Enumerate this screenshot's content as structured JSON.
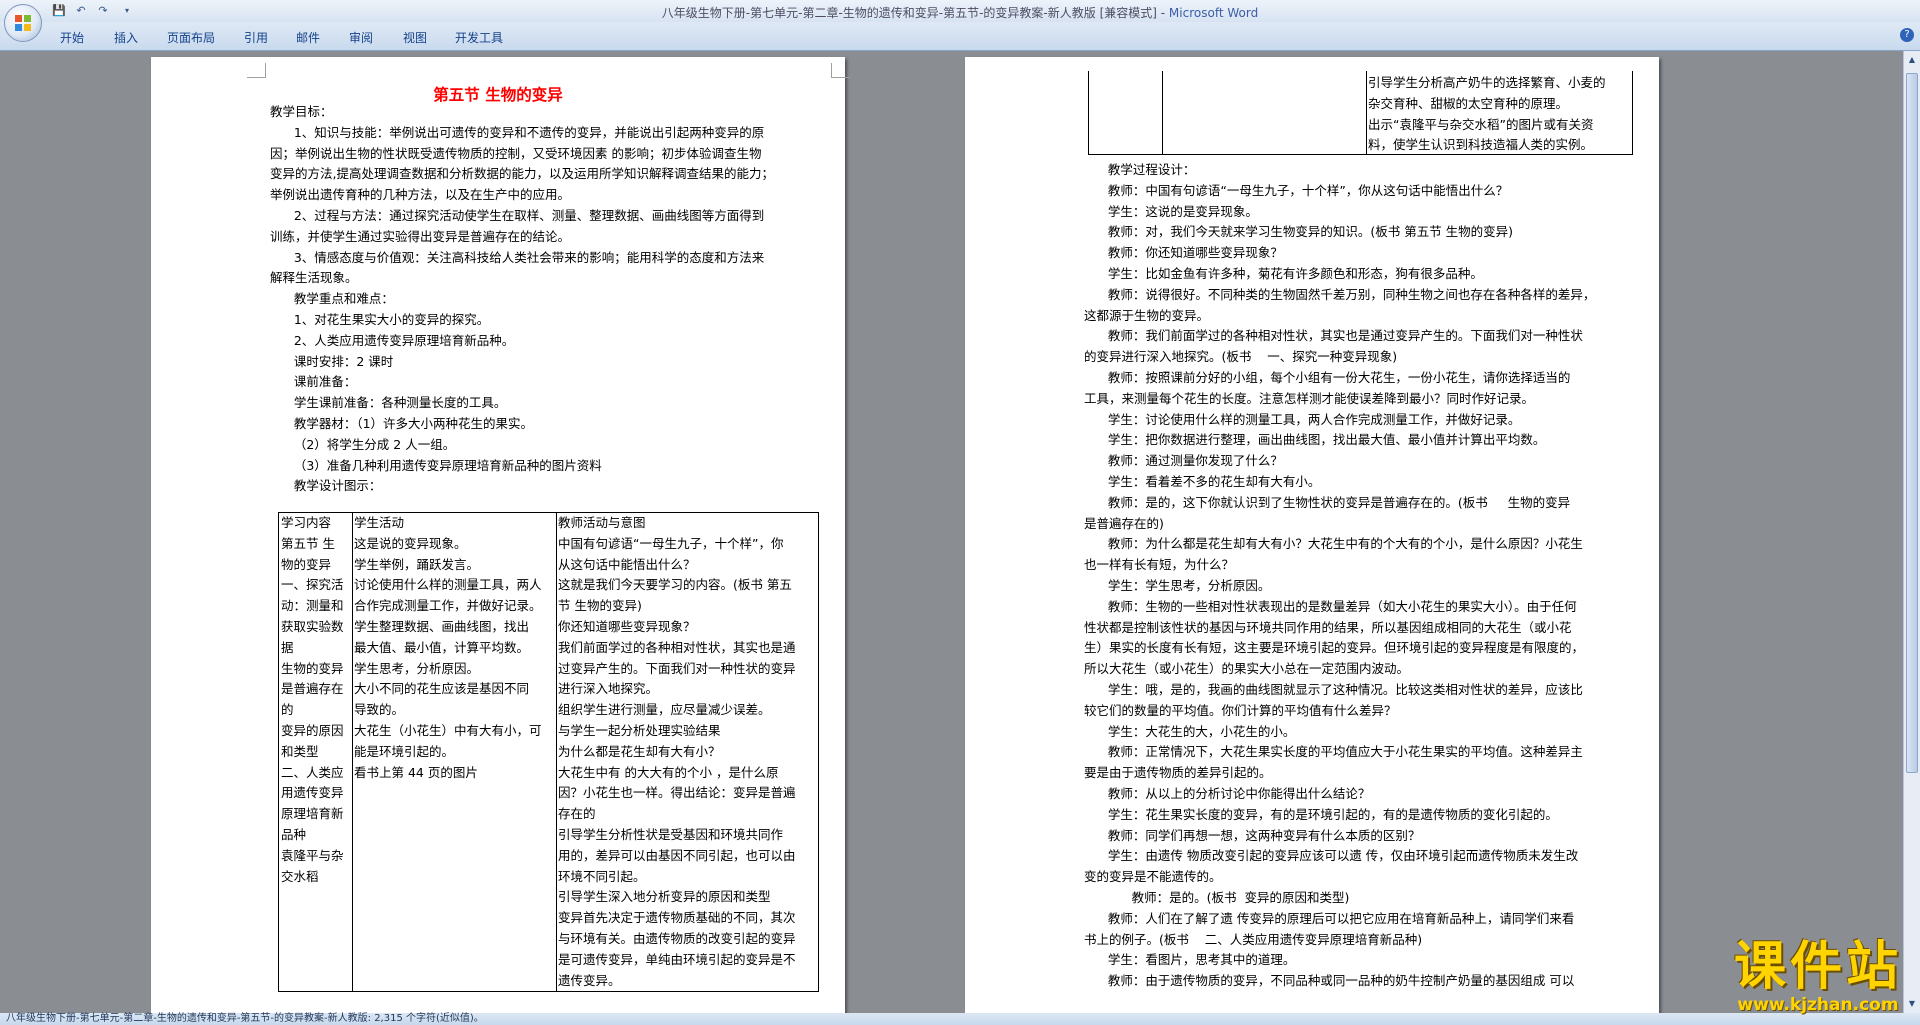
{
  "window": {
    "title": "八年级生物下册-第七单元-第二章-生物的遗传和变异-第五节-的变异教案-新人教版 [兼容模式]",
    "app_name": "Microsoft Word"
  },
  "quick_access": {
    "save_icon": "save-icon",
    "undo_icon": "undo-icon",
    "redo_icon": "redo-icon"
  },
  "ribbon": {
    "tabs": [
      "开始",
      "插入",
      "页面布局",
      "引用",
      "邮件",
      "审阅",
      "视图",
      "开发工具"
    ]
  },
  "left_page": {
    "title": "第五节  生物的变异",
    "lines": [
      "教学目标：",
      "      1、知识与技能：举例说出可遗传的变异和不遗传的变异，并能说出引起两种变异的原",
      "因；举例说出生物的性状既受遗传物质的控制，又受环境因素 的影响；初步体验调查生物",
      "变异的方法,提高处理调查数据和分析数据的能力，以及运用所学知识解释调查结果的能力；",
      "举例说出遗传育种的几种方法，以及在生产中的应用。",
      "      2、过程与方法：通过探究活动使学生在取样、测量、整理数据、画曲线图等方面得到",
      "训练，并使学生通过实验得出变异是普遍存在的结论。",
      "      3、情感态度与价值观：关注高科技给人类社会带来的影响；能用科学的态度和方法来",
      "解释生活现象。",
      "      教学重点和难点：",
      "      1、对花生果实大小的变异的探究。",
      "      2、人类应用遗传变异原理培育新品种。",
      "      课时安排：2 课时",
      "      课前准备：",
      "      学生课前准备：各种测量长度的工具。",
      "      教学器材：（1）许多大小两种花生的果实。",
      "      （2）将学生分成 2 人一组。",
      "      （3）准备几种利用遗传变异原理培育新品种的图片资料",
      "      教学设计图示："
    ],
    "table": {
      "col1": [
        "学习内容",
        "第五节  生",
        "物的变异",
        "一、探究活",
        "动：测量和",
        "获取实验数",
        "据",
        "生物的变异",
        "是普遍存在",
        "的",
        "变异的原因",
        "和类型",
        "二、人类应",
        "用遗传变异",
        "原理培育新",
        "品种",
        "袁隆平与杂",
        "交水稻"
      ],
      "col2": [
        "学生活动",
        "这是说的变异现象。",
        "学生举例，踊跃发言。",
        "讨论使用什么样的测量工具，两人",
        "合作完成测量工作，并做好记录。",
        "学生整理数据、画曲线图，找出",
        "最大值、最小值，计算平均数。",
        "学生思考，分析原因。",
        "大小不同的花生应该是基因不同",
        "导致的。",
        "大花生（小花生）中有大有小，可",
        "能是环境引起的。",
        "看书上第 44 页的图片"
      ],
      "col3": [
        "教师活动与意图",
        "中国有句谚语“一母生九子，十个样”，你",
        "从这句话中能悟出什么？",
        "这就是我们今天要学习的内容。(板书 第五",
        "节 生物的变异)",
        "你还知道哪些变异现象？",
        "我们前面学过的各种相对性状，其实也是通",
        "过变异产生的。下面我们对一种性状的变异",
        "进行深入地探究。",
        "组织学生进行测量，应尽量减少误差。",
        "与学生一起分析处理实验结果",
        "为什么都是花生却有大有小？",
        "大花生中有 的大大有的个小 ，是什么原",
        "因？小花生也一样。得出结论：变异是普遍",
        "存在的",
        "引导学生分析性状是受基因和环境共同作",
        "用的，差异可以由基因不同引起，也可以由",
        "环境不同引起。",
        "引导学生深入地分析变异的原因和类型",
        "变异首先决定于遗传物质基础的不同，其次",
        "与环境有关。由遗传物质的改变引起的变异",
        "是可遗传变异，单纯由环境引起的变异是不",
        "遗传变异。"
      ]
    }
  },
  "right_page": {
    "fragment": [
      "引导学生分析高产奶牛的选择繁育、小麦的",
      "杂交育种、甜椒的太空育种的原理。",
      "出示“袁隆平与杂交水稻”的图片或有关资",
      "料，使学生认识到科技造福人类的实例。"
    ],
    "lines": [
      "      教学过程设计：",
      "      教师：中国有句谚语“一母生九子，十个样”，你从这句话中能悟出什么？",
      "      学生：这说的是变异现象。",
      "      教师：对，我们今天就来学习生物变异的知识。(板书 第五节 生物的变异)",
      "      教师：你还知道哪些变异现象？",
      "      学生：比如金鱼有许多种，菊花有许多颜色和形态，狗有很多品种。",
      "      教师：说得很好。不同种类的生物固然千差万别，同种生物之间也存在各种各样的差异，",
      "这都源于生物的变异。",
      "      教师：我们前面学过的各种相对性状，其实也是通过变异产生的。下面我们对一种性状",
      "的变异进行深入地探究。(板书    一、探究一种变异现象)",
      "      教师：按照课前分好的小组，每个小组有一份大花生，一份小花生，请你选择适当的",
      "工具，来测量每个花生的长度。注意怎样测才能使误差降到最小？同时作好记录。",
      "      学生：讨论使用什么样的测量工具，两人合作完成测量工作，并做好记录。",
      "      学生：把你数据进行整理，画出曲线图，找出最大值、最小值并计算出平均数。",
      "      教师：通过测量你发现了什么？",
      "      学生：看着差不多的花生却有大有小。",
      "      教师：是的，这下你就认识到了生物性状的变异是普遍存在的。(板书     生物的变异",
      "是普遍存在的)",
      "      教师：为什么都是花生却有大有小？大花生中有的个大有的个小，是什么原因？小花生",
      "也一样有长有短，为什么？",
      "      学生：学生思考，分析原因。",
      "      教师：生物的一些相对性状表现出的是数量差异（如大小花生的果实大小）。由于任何",
      "性状都是控制该性状的基因与环境共同作用的结果，所以基因组成相同的大花生（或小花",
      "生）果实的长度有长有短，这主要是环境引起的变异。但环境引起的变异程度是有限度的，",
      "所以大花生（或小花生）的果实大小总在一定范围内波动。",
      "      学生：哦，是的，我画的曲线图就显示了这种情况。比较这类相对性状的差异，应该比",
      "较它们的数量的平均值。你们计算的平均值有什么差异？",
      "      学生：大花生的大，小花生的小。",
      "      教师：正常情况下，大花生果实长度的平均值应大于小花生果实的平均值。这种差异主",
      "要是由于遗传物质的差异引起的。",
      "      教师：从以上的分析讨论中你能得出什么结论？",
      "      学生：花生果实长度的变异，有的是环境引起的，有的是遗传物质的变化引起的。",
      "      教师：同学们再想一想，这两种变异有什么本质的区别？",
      "      学生：由遗传 物质改变引起的变异应该可以遗 传，仅由环境引起而遗传物质未发生改",
      "变的变异是不能遗传的。",
      "            教师：是的。(板书  变异的原因和类型)",
      "      教师：人们在了解了遗 传变异的原理后可以把它应用在培育新品种上，请同学们来看",
      "书上的例子。(板书    二、人类应用遗传变异原理培育新品种)",
      "      学生：看图片，思考其中的道理。",
      "      教师：由于遗传物质的变异，不同品种或同一品种的奶牛控制产奶量的基因组成 可以"
    ]
  },
  "status_bar": {
    "text": "八年级生物下册-第七单元-第二章-生物的遗传和变异-第五节-的变异教案-新人教版: 2,315 个字符(近似值)。"
  },
  "watermark": {
    "text": "课件站",
    "url": "www.kjzhan.com"
  }
}
